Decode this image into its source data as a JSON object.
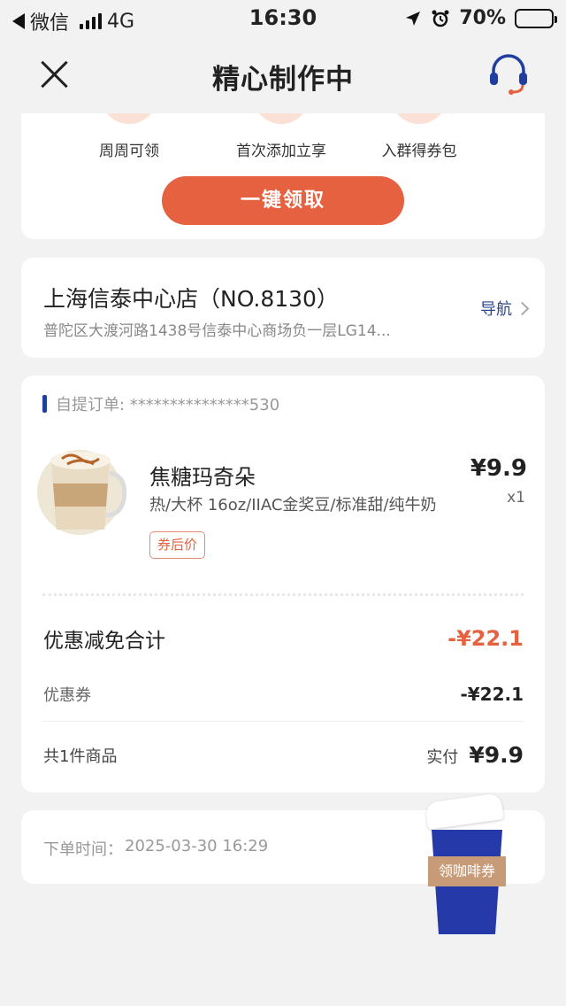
{
  "status_bar": {
    "carrier": "微信",
    "network": "4G",
    "time": "16:30",
    "battery": "70%"
  },
  "nav": {
    "title": "精心制作中"
  },
  "perks": [
    {
      "label": "周周可领"
    },
    {
      "label": "首次添加立享"
    },
    {
      "label": "入群得券包"
    }
  ],
  "claim_button": "一键领取",
  "store": {
    "name": "上海信泰中心店（NO.8130）",
    "address": "普陀区大渡河路1438号信泰中心商场负一层LG14...",
    "nav_label": "导航"
  },
  "order": {
    "number_label": "自提订单: ***************530",
    "product": {
      "name": "焦糖玛奇朵",
      "spec": "热/大杯 16oz/IIAC金奖豆/标准甜/纯牛奶",
      "tag": "券后价",
      "price": "¥9.9",
      "qty": "x1"
    },
    "discount_total_label": "优惠减免合计",
    "discount_total_value": "-¥22.1",
    "coupon_label": "优惠券",
    "coupon_value": "-¥22.1",
    "count_label": "共1件商品",
    "paid_label": "实付",
    "paid_value": "¥9.9"
  },
  "order_time": {
    "label": "下单时间：",
    "value": "2025-03-30 16:29"
  },
  "float_coupon": {
    "label": "领咖啡券"
  },
  "colors": {
    "accent": "#e5613f",
    "brand_blue": "#253aa8"
  }
}
